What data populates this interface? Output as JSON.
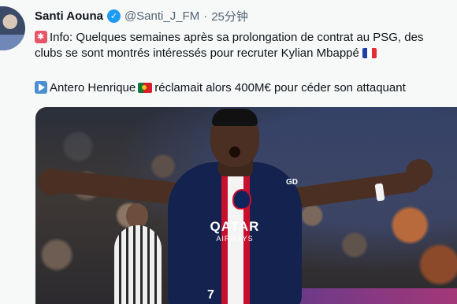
{
  "tweet": {
    "author_name": "Santi Aouna",
    "handle": "@Santi_J_FM",
    "separator": "·",
    "time": "25分钟",
    "line1": "Info: Quelques semaines après sa prolongation de contrat au PSG, des",
    "line2": "clubs se sont montrés intéressés pour recruter Kylian Mbappé",
    "line3_a": "Antero Henrique",
    "line3_b": "réclamait alors 400M€ pour céder son attaquant"
  },
  "photo": {
    "sponsor": "QATAR",
    "sponsor_sub": "AIRWAYS",
    "badge": "GD",
    "number": "7"
  },
  "icons": {
    "verified": "verified-badge-icon",
    "pin_emoji": "alert-emoji-icon",
    "play_emoji": "play-emoji-icon",
    "flag_fr": "france-flag-icon",
    "flag_pt": "portugal-flag-icon"
  },
  "colors": {
    "verified": "#1d9bf0",
    "handle": "#536471",
    "text": "#0f1419"
  }
}
